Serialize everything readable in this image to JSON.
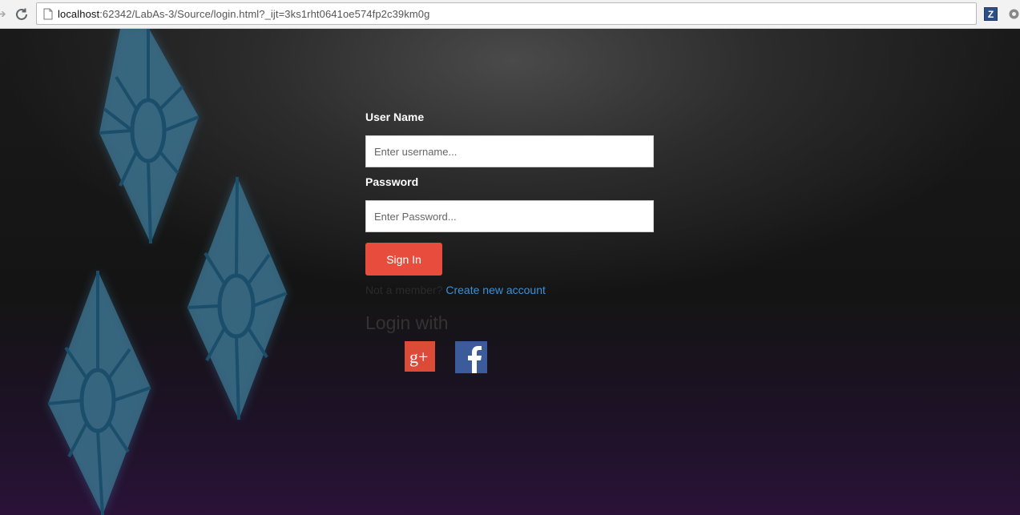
{
  "browser": {
    "url_host": "localhost",
    "url_rest": ":62342/LabAs-3/Source/login.html?_ijt=3ks1rht0641oe574fp2c39km0g",
    "extension_icon_label": "Z",
    "icons": [
      "back-arrow-icon",
      "reload-icon",
      "page-icon",
      "extension-z-icon",
      "extension-gear-icon"
    ]
  },
  "form": {
    "username_label": "User Name",
    "username_placeholder": "Enter username...",
    "password_label": "Password",
    "password_placeholder": "Enter Password...",
    "signin_label": "Sign In",
    "not_member_text": "Not a member?",
    "create_account_link": "Create new account",
    "login_with_text": "Login with"
  },
  "social": {
    "google_label": "g+",
    "icons": [
      "google-plus-icon",
      "facebook-icon"
    ]
  },
  "colors": {
    "signin_button": "#e84c3d",
    "link": "#3d8fd6",
    "google": "#dc4a38",
    "facebook": "#3b5b9b",
    "gem": "#3a6c86"
  }
}
